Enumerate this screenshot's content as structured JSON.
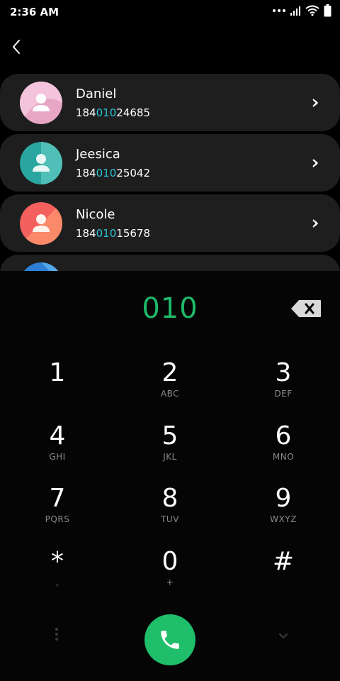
{
  "status_bar": {
    "time": "2:36 AM"
  },
  "contacts": [
    {
      "name": "Daniel",
      "num_prefix": "184",
      "num_match": "010",
      "num_suffix": "24685",
      "avatar_colors": [
        "#e7a6c4",
        "#f4c4dc"
      ]
    },
    {
      "name": "Jeesica",
      "num_prefix": "184",
      "num_match": "010",
      "num_suffix": "25042",
      "avatar_colors": [
        "#2aa6a0",
        "#4fbfb7"
      ]
    },
    {
      "name": "Nicole",
      "num_prefix": "184",
      "num_match": "010",
      "num_suffix": "15678",
      "avatar_colors": [
        "#f3605d",
        "#fb8a6a"
      ]
    },
    {
      "name": "",
      "num_prefix": "",
      "num_match": "",
      "num_suffix": "",
      "avatar_colors": [
        "#2f7fd6",
        "#54a8e8"
      ]
    }
  ],
  "dialpad": {
    "entered_number": "010",
    "keys": [
      {
        "digit": "1",
        "letters": ""
      },
      {
        "digit": "2",
        "letters": "ABC"
      },
      {
        "digit": "3",
        "letters": "DEF"
      },
      {
        "digit": "4",
        "letters": "GHI"
      },
      {
        "digit": "5",
        "letters": "JKL"
      },
      {
        "digit": "6",
        "letters": "MNO"
      },
      {
        "digit": "7",
        "letters": "PQRS"
      },
      {
        "digit": "8",
        "letters": "TUV"
      },
      {
        "digit": "9",
        "letters": "WXYZ"
      },
      {
        "digit": "*",
        "letters": ","
      },
      {
        "digit": "0",
        "letters": "+"
      },
      {
        "digit": "#",
        "letters": ""
      }
    ]
  },
  "colors": {
    "accent": "#1fb86a",
    "match_highlight": "#29c2d6",
    "call_button": "#1fbe6b"
  },
  "icons": {
    "back": "chevron-left-icon",
    "contact_open": "double-chevron-right-icon",
    "backspace": "backspace-icon",
    "call": "phone-icon",
    "more": "vertical-dots-icon",
    "collapse": "chevron-down-icon"
  }
}
